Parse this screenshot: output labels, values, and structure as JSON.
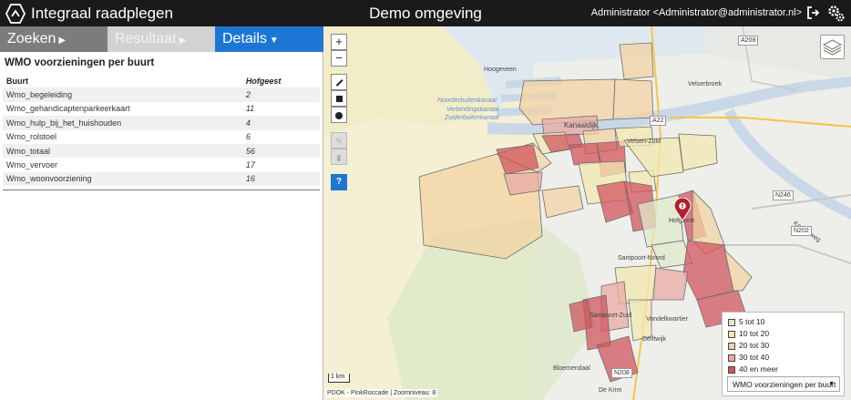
{
  "header": {
    "app_title": "Integraal raadplegen",
    "environment": "Demo omgeving",
    "user": "Administrator <Administrator@administrator.nl>"
  },
  "tabs": [
    {
      "label": "Zoeken"
    },
    {
      "label": "Resultaat"
    },
    {
      "label": "Details"
    }
  ],
  "details": {
    "title": "WMO voorzieningen per buurt",
    "col_name": "Buurt",
    "col_value": "Hofgeest",
    "rows": [
      {
        "name": "Wmo_begeleiding",
        "value": "2"
      },
      {
        "name": "Wmo_gehandicaptenparkeerkaart",
        "value": "11"
      },
      {
        "name": "Wmo_hulp_bij_het_huishouden",
        "value": "4"
      },
      {
        "name": "Wmo_rolstoel",
        "value": "6"
      },
      {
        "name": "Wmo_totaal",
        "value": "56"
      },
      {
        "name": "Wmo_vervoer",
        "value": "17"
      },
      {
        "name": "Wmo_woonvoorziening",
        "value": "16"
      }
    ]
  },
  "map": {
    "labels": {
      "hoogeveen": "Hoogeveen",
      "noorderbuitenkanaal": "Noorderbuitenkanaal",
      "verbindingskanaal": "Verbindingskanaal",
      "zuiderbuitenkanaal": "Zuiderbuitenkanaal",
      "kanaaldijk": "Kanaaldijk",
      "velsen_zuid": "Velsen-Zuid",
      "hofgeest": "Hofgeest",
      "santpoort_noord": "Santpoort-Noord",
      "santpoort_zuid": "Santpoort-Zuid",
      "vondelkwartier": "Vondelkwartier",
      "delftwijk": "Delftwijk",
      "bloemendaal": "Bloemendaal",
      "de_krim": "De Krim",
      "kanaalweg": "Kanaalweg",
      "velserbroek": "Velserbroek"
    },
    "roads": {
      "a22": "A22",
      "n246": "N246",
      "n202": "N202",
      "n208": "N208",
      "a208": "A208"
    },
    "scale": "1 km",
    "attribution": "PDOK - PinkRoccade | Zoomniveau: 8",
    "legend": {
      "items": [
        {
          "label": "5 tot 10",
          "color": "#dfe9c9"
        },
        {
          "label": "10 tot 20",
          "color": "#f3e8b0"
        },
        {
          "label": "20 tot 30",
          "color": "#f1d3a3"
        },
        {
          "label": "30 tot 40",
          "color": "#e9a9a6"
        },
        {
          "label": "40 en meer",
          "color": "#d2555f"
        }
      ],
      "selected": "WMO voorzieningen per buurt"
    }
  }
}
